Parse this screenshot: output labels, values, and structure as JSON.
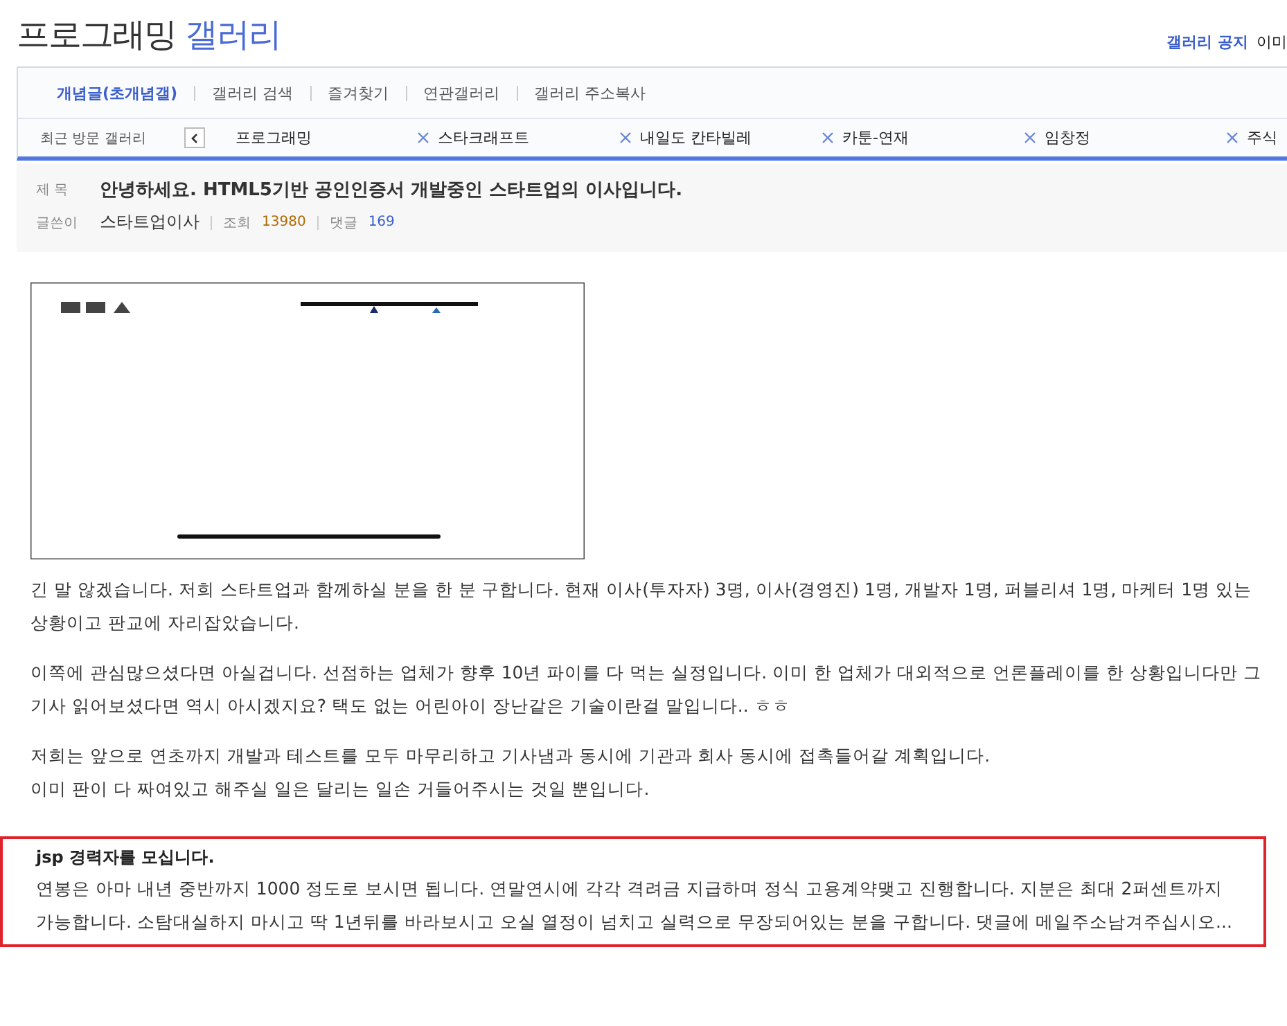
{
  "header": {
    "title_main": "프로그래밍",
    "title_accent": "갤러리",
    "links": [
      "갤러리 공지",
      "이미"
    ]
  },
  "tabs": [
    {
      "label": "개념글(초개념갤)",
      "selected": true
    },
    {
      "label": "갤러리 검색",
      "selected": false
    },
    {
      "label": "즐겨찾기",
      "selected": false
    },
    {
      "label": "연관갤러리",
      "selected": false
    },
    {
      "label": "갤러리 주소복사",
      "selected": false
    }
  ],
  "recent": {
    "label": "최근 방문 갤러리",
    "items": [
      {
        "name": "프로그래밍"
      },
      {
        "name": "스타크래프트"
      },
      {
        "name": "내일도 칸타빌레"
      },
      {
        "name": "카툰-연재"
      },
      {
        "name": "임창정"
      },
      {
        "name": "주식"
      }
    ]
  },
  "post": {
    "subject_label": "제 목",
    "subject": "안녕하세요. HTML5기반 공인인증서 개발중인 스타트업의 이사입니다.",
    "author_label": "글쓴이",
    "author": "스타트업이사",
    "views_label": "조회",
    "views": "13980",
    "comments_label": "댓글",
    "comments": "169"
  },
  "body": {
    "image": {
      "kind": "picture"
    },
    "paragraphs": [
      [
        "긴 말 않겠습니다. 저희 스타트업과 함께하실 분을 한 분 구합니다. 현재 이사(투자자) 3명, 이사(경영진) 1명, 개발자 1명, 퍼블리셔 1명, 마케터 1명 있는 상황이고 판교에 자리잡았습니다."
      ],
      [
        "이쪽에 관심많으셨다면 아실겁니다. 선점하는 업체가 향후 10년 파이를 다 먹는 실정입니다. 이미 한 업체가 대외적으로 언론플레이를 한 상황입니다만 그 기사 읽어보셨다면 역시 아시겠지요? 택도 없는 어린아이 장난같은 기술이란걸 말입니다.. ㅎㅎ"
      ],
      [
        "저희는 앞으로 연초까지 개발과 테스트를 모두 마무리하고 기사냄과 동시에 기관과 회사 동시에 접촉들어갈 계획입니다.",
        "이미 판이 다 짜여있고 해주실 일은 달리는 일손 거들어주시는 것일 뿐입니다."
      ]
    ],
    "highlight": {
      "heading": "jsp 경력자를 모십니다.",
      "text": "연봉은 아마 내년 중반까지 1000 정도로 보시면 됩니다. 연말연시에 각각 격려금 지급하며 정식 고용계약맺고 진행합니다. 지분은 최대 2퍼센트까지 가능합니다. 소탐대실하지 마시고 딱 1년뒤를 바라보시고 오실 열정이 넘치고 실력으로 무장되어있는 분을 구합니다. 댓글에 메일주소남겨주십시오..."
    }
  }
}
